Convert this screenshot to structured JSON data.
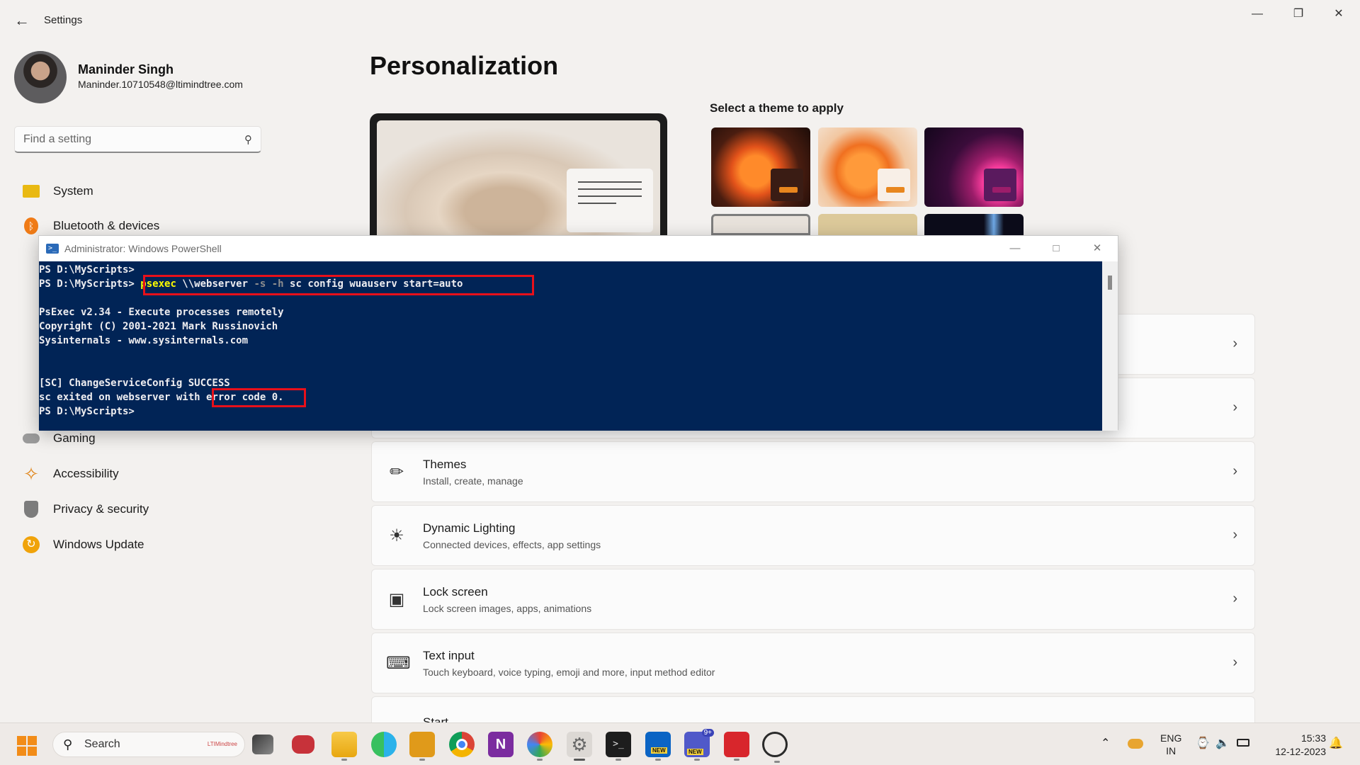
{
  "window": {
    "title": "Settings"
  },
  "controls": {
    "minimize": "—",
    "restore": "❐",
    "close": "✕"
  },
  "profile": {
    "name": "Maninder Singh",
    "email": "Maninder.10710548@ltimindtree.com"
  },
  "search": {
    "placeholder": "Find a setting"
  },
  "nav": {
    "items": [
      {
        "label": "System"
      },
      {
        "label": "Bluetooth & devices"
      },
      {
        "label": "Gaming"
      },
      {
        "label": "Accessibility"
      },
      {
        "label": "Privacy & security"
      },
      {
        "label": "Windows Update"
      }
    ]
  },
  "page": {
    "title": "Personalization",
    "theme_heading": "Select a theme to apply"
  },
  "settings_rows": [
    {
      "title": "Themes",
      "subtitle": "Install, create, manage"
    },
    {
      "title": "Dynamic Lighting",
      "subtitle": "Connected devices, effects, app settings"
    },
    {
      "title": "Lock screen",
      "subtitle": "Lock screen images, apps, animations"
    },
    {
      "title": "Text input",
      "subtitle": "Touch keyboard, voice typing, emoji and more, input method editor"
    },
    {
      "title": "Start",
      "subtitle": ""
    }
  ],
  "powershell": {
    "title": "Administrator: Windows PowerShell",
    "lines": {
      "l1": "PS D:\\MyScripts>",
      "l2_prompt": "PS D:\\MyScripts>",
      "l2_cmd": "psexec",
      "l2_arg1": " \\\\webserver ",
      "l2_flags": "-s -h",
      "l2_rest": " sc config wuauserv start=auto",
      "l3": "PsExec v2.34 - Execute processes remotely",
      "l4": "Copyright (C) 2001-2021 Mark Russinovich",
      "l5": "Sysinternals - www.sysinternals.com",
      "l6": "[SC] ChangeServiceConfig SUCCESS",
      "l7_a": "sc exited on webserver with",
      "l7_b": " error code 0.",
      "l8": "PS D:\\MyScripts>"
    }
  },
  "taskbar": {
    "search_label": "Search",
    "search_logo": "LTIMindtree",
    "lang_top": "ENG",
    "lang_bottom": "IN",
    "time": "15:33",
    "date": "12-12-2023",
    "badge_teams": "9+",
    "badge_new1": "NEW",
    "badge_new2": "NEW"
  },
  "colors": {
    "console_bg": "#012456",
    "highlight": "#e8101a",
    "accent": "#0067c0"
  }
}
